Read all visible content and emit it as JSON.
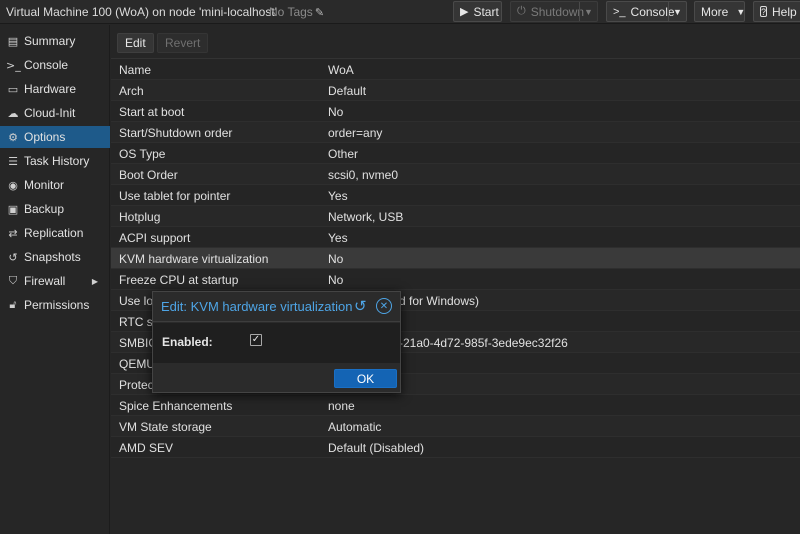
{
  "window": {
    "title": "Virtual Machine 100 (WoA) on node 'mini-localhost'",
    "tags": "No Tags"
  },
  "header_buttons": {
    "start": "Start",
    "shutdown": "Shutdown",
    "console": "Console",
    "more": "More",
    "help": "Help"
  },
  "sidebar": {
    "items": [
      {
        "label": "Summary",
        "icon": "summary-icon"
      },
      {
        "label": "Console",
        "icon": "terminal-icon"
      },
      {
        "label": "Hardware",
        "icon": "monitor-icon"
      },
      {
        "label": "Cloud-Init",
        "icon": "cloud-icon"
      },
      {
        "label": "Options",
        "icon": "gear-icon",
        "active": true
      },
      {
        "label": "Task History",
        "icon": "list-icon"
      },
      {
        "label": "Monitor",
        "icon": "eye-icon"
      },
      {
        "label": "Backup",
        "icon": "floppy-icon"
      },
      {
        "label": "Replication",
        "icon": "retweet-icon"
      },
      {
        "label": "Snapshots",
        "icon": "history-icon"
      },
      {
        "label": "Firewall",
        "icon": "shield-icon"
      },
      {
        "label": "Permissions",
        "icon": "unlock-icon"
      }
    ]
  },
  "toolbar": {
    "edit": "Edit",
    "revert": "Revert"
  },
  "options": {
    "rows": [
      {
        "key": "Name",
        "value": "WoA"
      },
      {
        "key": "Arch",
        "value": "Default"
      },
      {
        "key": "Start at boot",
        "value": "No"
      },
      {
        "key": "Start/Shutdown order",
        "value": "order=any"
      },
      {
        "key": "OS Type",
        "value": "Other"
      },
      {
        "key": "Boot Order",
        "value": "scsi0, nvme0"
      },
      {
        "key": "Use tablet for pointer",
        "value": "Yes"
      },
      {
        "key": "Hotplug",
        "value": "Network, USB"
      },
      {
        "key": "ACPI support",
        "value": "Yes"
      },
      {
        "key": "KVM hardware virtualization",
        "value": "No",
        "selected": true
      },
      {
        "key": "Freeze CPU at startup",
        "value": "No"
      },
      {
        "key": "Use lo",
        "value": "d for Windows)"
      },
      {
        "key": "RTC s",
        "value": ""
      },
      {
        "key": "SMBIO",
        "value": "-21a0-4d72-985f-3ede9ec32f26"
      },
      {
        "key": "QEMU",
        "value": ""
      },
      {
        "key": "Protec",
        "value": ""
      },
      {
        "key": "Spice Enhancements",
        "value": "none"
      },
      {
        "key": "VM State storage",
        "value": "Automatic"
      },
      {
        "key": "AMD SEV",
        "value": "Default (Disabled)"
      }
    ]
  },
  "dialog": {
    "title": "Edit: KVM hardware virtualization",
    "field_label": "Enabled:",
    "checked_glyph": "☑",
    "ok": "OK"
  },
  "colors": {
    "accent": "#4ea5e6",
    "active_nav": "#1e5a8a",
    "primary_button": "#1464b4"
  }
}
